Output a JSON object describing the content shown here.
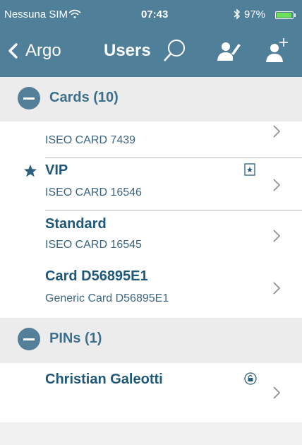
{
  "status": {
    "carrier": "Nessuna SIM",
    "time": "07:43",
    "battery_percent": "97%",
    "battery_level": 0.97
  },
  "nav": {
    "back_label": "Argo",
    "title": "Users"
  },
  "sections": [
    {
      "label": "Cards (10)",
      "rows": [
        {
          "name": "",
          "sub": "ISEO CARD 7439",
          "starred": false,
          "badge": ""
        },
        {
          "name": "VIP",
          "sub": "ISEO CARD 16546",
          "starred": true,
          "badge": "card-star-icon"
        },
        {
          "name": "Standard",
          "sub": "ISEO CARD 16545",
          "starred": false,
          "badge": ""
        },
        {
          "name": "Card D56895E1",
          "sub": "Generic Card D56895E1",
          "starred": false,
          "badge": ""
        }
      ]
    },
    {
      "label": "PINs (1)",
      "rows": [
        {
          "name": "Christian Galeotti",
          "sub": "",
          "starred": false,
          "badge": "lock-icon"
        }
      ]
    }
  ],
  "colors": {
    "header": "#4f7f99",
    "accent": "#537f98",
    "text": "#1f5878",
    "battery": "#6fe05b"
  }
}
